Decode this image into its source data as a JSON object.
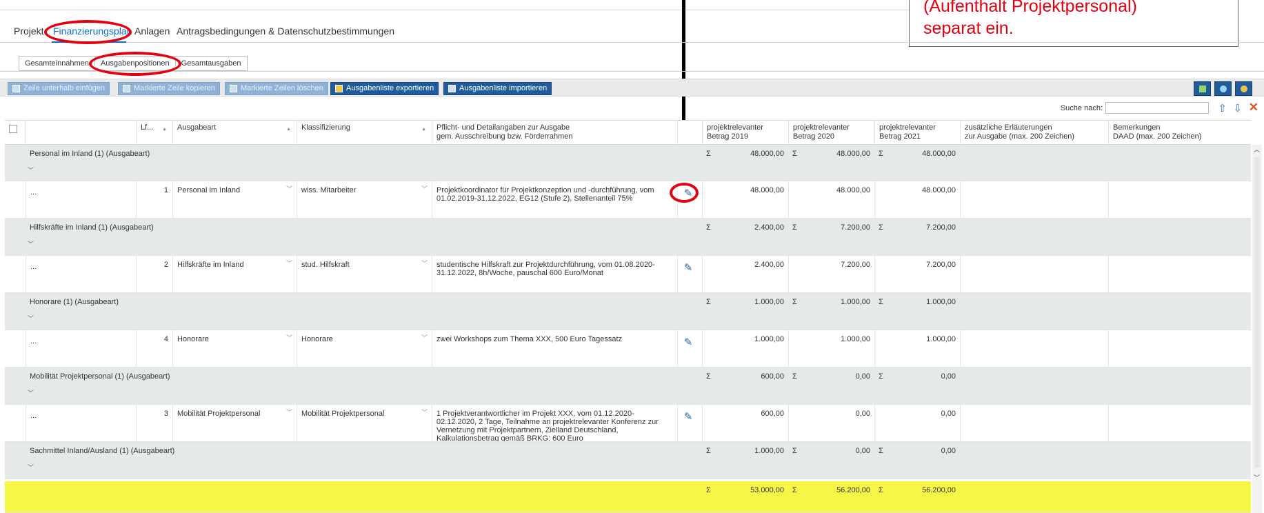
{
  "callout": {
    "line1": "(Aufenthalt Projektpersonal)",
    "line2": "separat ein."
  },
  "main_tabs": [
    "Projekt",
    "Finanzierungsplan",
    "Anlagen",
    "Antragsbedingungen & Datenschutzbestimmungen"
  ],
  "sub_tabs": [
    "Gesamteinnahmen",
    "Ausgabenpositionen",
    "Gesamtausgaben"
  ],
  "toolbar": {
    "insert_row": "Zeile unterhalb einfügen",
    "copy_row": "Markierte Zeile kopieren",
    "delete_rows": "Markierte Zeilen löschen",
    "export_list": "Ausgabenliste exportieren",
    "import_list": "Ausgabenliste importieren"
  },
  "search": {
    "label": "Suche nach:",
    "value": ""
  },
  "columns": {
    "lfd": "Lf...",
    "ausgabeart": "Ausgabeart",
    "klassifizierung": "Klassifizierung",
    "pflicht_line1": "Pflicht- und Detailangaben zur Ausgabe",
    "pflicht_line2": "gem. Ausschreibung bzw. Förderrahmen",
    "betrag2019_line1": "projektrelevanter",
    "betrag2019_line2": "Betrag 2019",
    "betrag2020_line1": "projektrelevanter",
    "betrag2020_line2": "Betrag 2020",
    "betrag2021_line1": "projektrelevanter",
    "betrag2021_line2": "Betrag 2021",
    "erl_line1": "zusätzliche Erläuterungen",
    "erl_line2": "zur Ausgabe (max. 200 Zeichen)",
    "bem_line1": "Bemerkungen",
    "bem_line2": "DAAD (max. 200 Zeichen)"
  },
  "sigma": "Σ",
  "groups": [
    {
      "title": "Personal im Inland (1) (Ausgabeart)",
      "sum2019": "48.000,00",
      "sum2020": "48.000,00",
      "sum2021": "48.000,00",
      "item": {
        "dots": "...",
        "lfd": "1",
        "ausgabeart": "Personal im Inland",
        "klassifizierung": "wiss. Mitarbeiter",
        "desc": "Projektkoordinator für Projektkonzeption und -durchführung, vom 01.02.2019-31.12.2022, EG12 (Stufe 2), Stellenanteil 75%",
        "b2019": "48.000,00",
        "b2020": "48.000,00",
        "b2021": "48.000,00"
      }
    },
    {
      "title": "Hilfskräfte im Inland (1) (Ausgabeart)",
      "sum2019": "2.400,00",
      "sum2020": "7.200,00",
      "sum2021": "7.200,00",
      "item": {
        "dots": "...",
        "lfd": "2",
        "ausgabeart": "Hilfskräfte im Inland",
        "klassifizierung": "stud. Hilfskraft",
        "desc": "studentische Hilfskraft zur Projektdurchführung, vom 01.08.2020-31.12.2022, 8h/Woche, pauschal 600 Euro/Monat",
        "b2019": "2.400,00",
        "b2020": "7.200,00",
        "b2021": "7.200,00"
      }
    },
    {
      "title": "Honorare (1) (Ausgabeart)",
      "sum2019": "1.000,00",
      "sum2020": "1.000,00",
      "sum2021": "1.000,00",
      "item": {
        "dots": "...",
        "lfd": "4",
        "ausgabeart": "Honorare",
        "klassifizierung": "Honorare",
        "desc": "zwei Workshops zum Thema XXX, 500 Euro Tagessatz",
        "b2019": "1.000,00",
        "b2020": "1.000,00",
        "b2021": "1.000,00"
      }
    },
    {
      "title": "Mobilität Projektpersonal (1) (Ausgabeart)",
      "sum2019": "600,00",
      "sum2020": "0,00",
      "sum2021": "0,00",
      "item": {
        "dots": "...",
        "lfd": "3",
        "ausgabeart": "Mobilität Projektpersonal",
        "klassifizierung": "Mobilität Projektpersonal",
        "desc": "1 Projektverantwortlicher im Projekt XXX, vom 01.12.2020-02.12.2020, 2 Tage, Teilnahme an projektrelevanter Konferenz zur Vernetzung mit Projektpartnern, Zielland Deutschland, Kalkulationsbetrag gemäß BRKG: 600 Euro",
        "b2019": "600,00",
        "b2020": "0,00",
        "b2021": "0,00"
      }
    },
    {
      "title": "Sachmittel Inland/Ausland (1) (Ausgabeart)",
      "sum2019": "1.000,00",
      "sum2020": "0,00",
      "sum2021": "0,00"
    }
  ],
  "total": {
    "sum2019": "53.000,00",
    "sum2020": "56.200,00",
    "sum2021": "56.200,00"
  }
}
